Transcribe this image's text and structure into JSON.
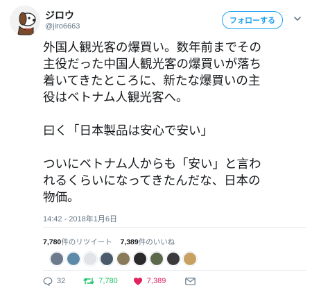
{
  "user": {
    "display_name": "ジロウ",
    "handle": "@jiro6663",
    "avatar_icon": "cartoon-dog-avatar"
  },
  "follow_button": {
    "label": "フォローする"
  },
  "tweet": {
    "text": "外国人観光客の爆買い。数年前までその\n主役だった中国人観光客の爆買いが落ち\n着いてきたところに、新たな爆買いの主\n役はベトナム人観光客へ。\n\n曰く「日本製品は安心で安い」\n\nついにベトナム人からも「安い」と言わ\nれるくらいになってきたんだな、日本の\n物価。",
    "timestamp": "14:42 - 2018年1月6日"
  },
  "stats": {
    "retweets_count": "7,780",
    "retweets_label": "件のリツイート",
    "likes_count": "7,389",
    "likes_label": "件のいいね"
  },
  "likers": [
    {
      "name": "liker-avatar-1",
      "color": "#6c7a8c"
    },
    {
      "name": "liker-avatar-2",
      "color": "#5d8aa8"
    },
    {
      "name": "liker-avatar-3",
      "color": "#e0e4e8"
    },
    {
      "name": "liker-avatar-4",
      "color": "#4a5a6a"
    },
    {
      "name": "liker-avatar-5",
      "color": "#8a7a5a"
    },
    {
      "name": "liker-avatar-6",
      "color": "#2a2a2a"
    },
    {
      "name": "liker-avatar-7",
      "color": "#5a6a4a"
    },
    {
      "name": "liker-avatar-8",
      "color": "#3a3a3a"
    },
    {
      "name": "liker-avatar-9",
      "color": "#c8a060"
    }
  ],
  "actions": {
    "reply_count": "32",
    "retweet_count": "7,780",
    "like_count": "7,389"
  },
  "colors": {
    "accent": "#1da1f2",
    "retweet": "#17bf63",
    "like": "#e0245e",
    "muted": "#657786"
  }
}
